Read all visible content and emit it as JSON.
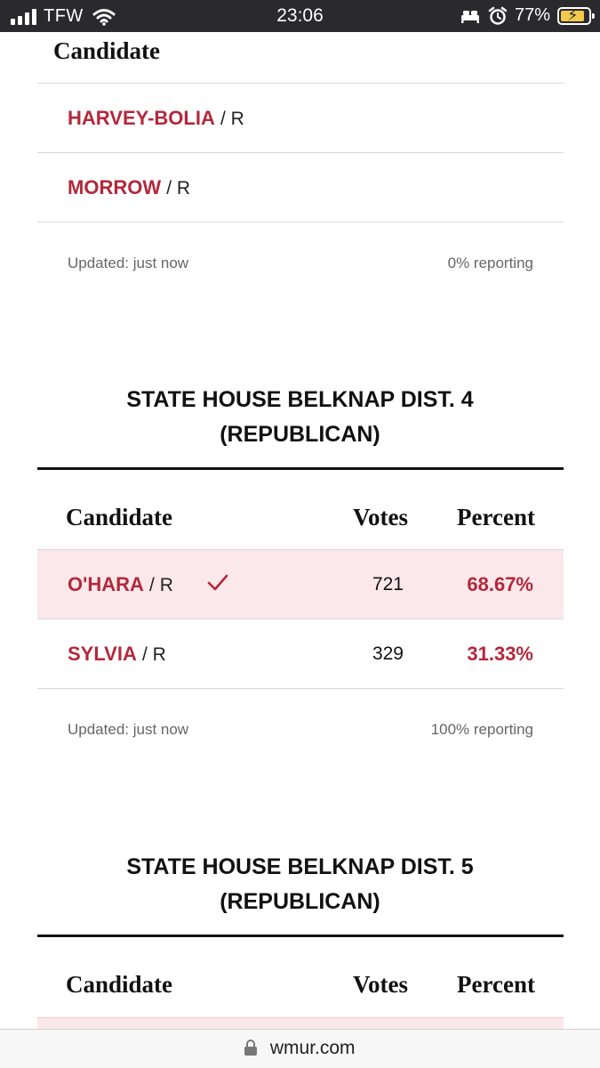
{
  "status_bar": {
    "carrier": "TFW",
    "time": "23:06",
    "battery_percent": "77%",
    "icons": [
      "signal-icon",
      "wifi-icon",
      "bed-icon",
      "alarm-icon",
      "battery-charging-icon"
    ]
  },
  "race_prev": {
    "header": "Candidate",
    "candidates": [
      {
        "name": "HARVEY-BOLIA",
        "party": "/ R"
      },
      {
        "name": "MORROW",
        "party": "/ R"
      }
    ],
    "updated": "Updated: just now",
    "reporting": "0% reporting"
  },
  "race_dist4": {
    "title_line1": "STATE HOUSE BELKNAP DIST. 4",
    "title_line2": "(REPUBLICAN)",
    "headers": {
      "candidate": "Candidate",
      "votes": "Votes",
      "percent": "Percent"
    },
    "candidates": [
      {
        "name": "O'HARA",
        "party": "/ R",
        "winner": true,
        "votes": "721",
        "percent": "68.67%"
      },
      {
        "name": "SYLVIA",
        "party": "/ R",
        "winner": false,
        "votes": "329",
        "percent": "31.33%"
      }
    ],
    "updated": "Updated: just now",
    "reporting": "100% reporting"
  },
  "race_dist5": {
    "title_line1": "STATE HOUSE BELKNAP DIST. 5",
    "title_line2": "(REPUBLICAN)",
    "headers": {
      "candidate": "Candidate",
      "votes": "Votes",
      "percent": "Percent"
    }
  },
  "browser": {
    "url": "wmur.com"
  },
  "colors": {
    "accent_red": "#b3283b",
    "winner_row_bg": "#fbe8ea",
    "status_bar_bg": "#2a2a2c"
  }
}
